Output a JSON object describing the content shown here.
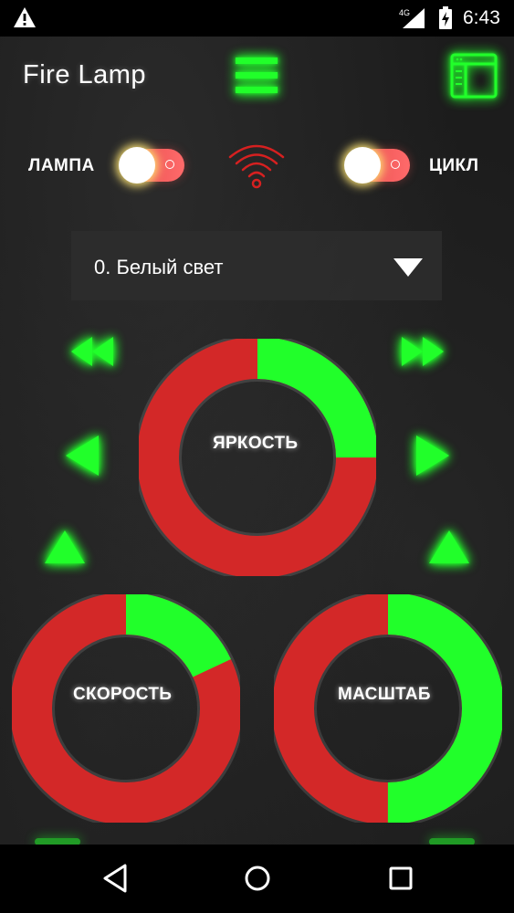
{
  "status_bar": {
    "network": "4G",
    "time": "6:43"
  },
  "header": {
    "title": "Fire Lamp",
    "menu_icon": "hamburger-menu-icon",
    "window_icon": "window-panel-icon"
  },
  "toggles": {
    "lamp": {
      "label": "ЛАМПА",
      "on": false
    },
    "cycle": {
      "label": "ЦИКЛ",
      "on": false
    },
    "wifi_icon": "wifi-icon"
  },
  "mode_select": {
    "selected": "0. Белый свет"
  },
  "dials": {
    "brightness": {
      "label": "ЯРКОСТЬ",
      "value_fraction": 0.25
    },
    "speed": {
      "label": "СКОРОСТЬ",
      "value_fraction": 0.18
    },
    "scale": {
      "label": "МАСШТАБ",
      "value_fraction": 0.5
    }
  },
  "colors": {
    "accent_green": "#21ff2a",
    "dial_red": "#d32828",
    "toggle_red": "#ff5a5a",
    "background": "#1c1c1c"
  }
}
